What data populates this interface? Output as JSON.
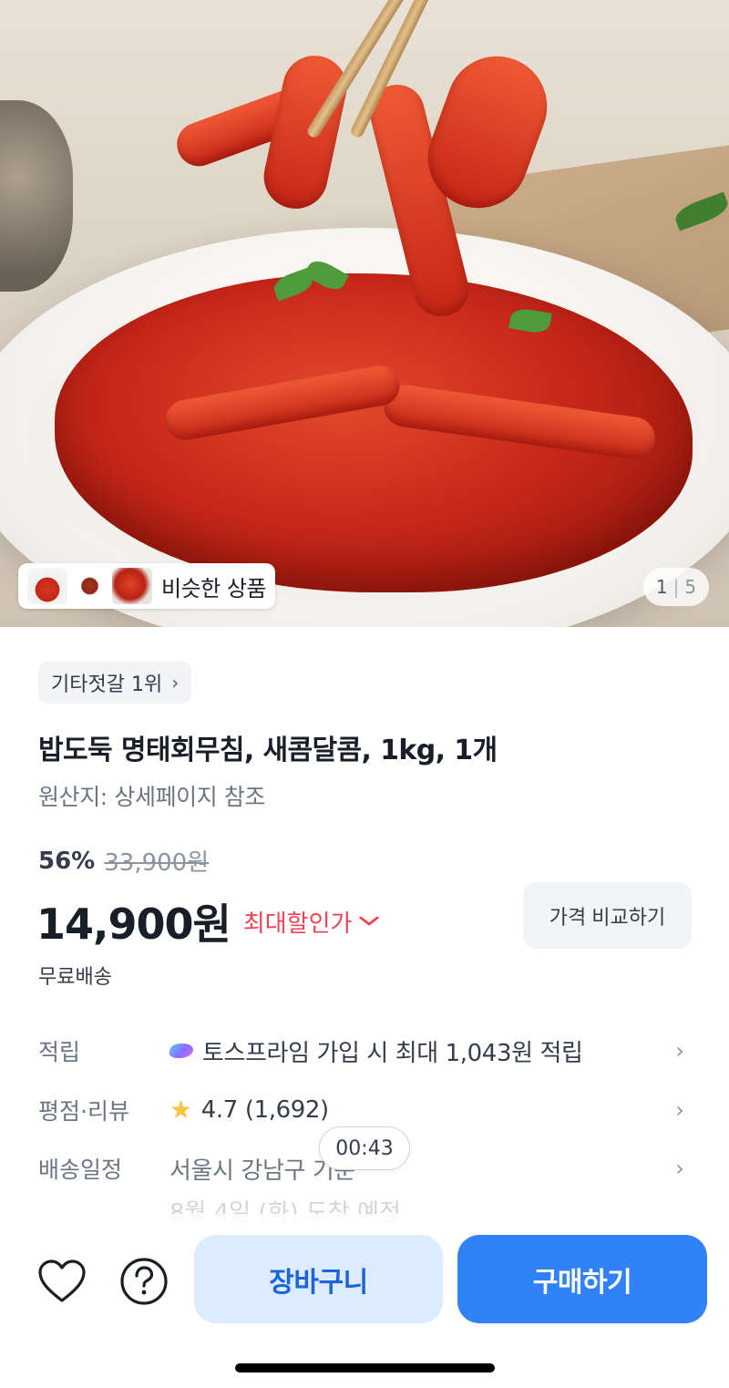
{
  "hero": {
    "similar_products_label": "비슷한 상품",
    "page_current": "1",
    "page_separator": "|",
    "page_total": "5"
  },
  "product": {
    "rank_label": "기타젓갈 1위",
    "title": "밥도둑 명태회무침, 새콤달콤, 1kg, 1개",
    "origin": "원산지: 상세페이지 참조",
    "discount_rate": "56%",
    "original_price": "33,900원",
    "sale_price": "14,900원",
    "max_discount_label": "최대할인가",
    "compare_button": "가격 비교하기",
    "shipping": "무료배송"
  },
  "info_rows": {
    "points": {
      "label": "적립",
      "value": "토스프라임 가입 시 최대 1,043원 적립"
    },
    "rating": {
      "label": "평점·리뷰",
      "score": "4.7",
      "count": "(1,692)"
    },
    "delivery": {
      "label": "배송일정",
      "value": "서울시 강남구 기준",
      "date": "8월 4일 (화) 도착 예정"
    }
  },
  "timer": "00:43",
  "actions": {
    "cart": "장바구니",
    "buy": "구매하기"
  },
  "colors": {
    "primary": "#3182f6",
    "primary_light": "#dcebfd",
    "discount_red": "#f04452",
    "star": "#ffc342"
  },
  "icons": {
    "rank_chevron": "›",
    "row_chevron": "›",
    "max_discount_chevron": "⌄",
    "star": "★"
  }
}
